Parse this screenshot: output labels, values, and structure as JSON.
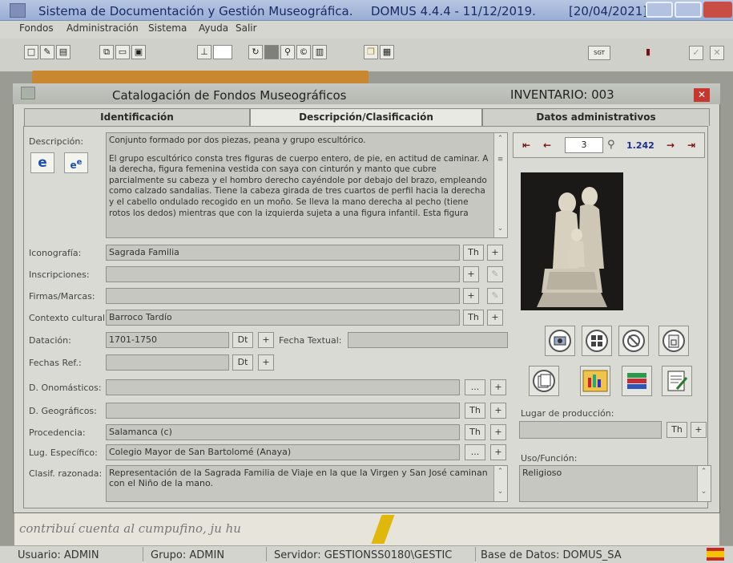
{
  "app": {
    "title": "Sistema de Documentación y Gestión Museográfica.",
    "version": "DOMUS 4.4.4 - 11/12/2019.",
    "date": "[20/04/2021]"
  },
  "menu": [
    "Fondos",
    "Administración",
    "Sistema",
    "Ayuda",
    "Salir"
  ],
  "dialog": {
    "title": "Catalogación de Fondos Museográficos",
    "inventory": "INVENTARIO: 003",
    "tabs": [
      "Identificación",
      "Descripción/Clasificación",
      "Datos administrativos"
    ],
    "active_tab": "Descripción/Clasificación"
  },
  "navigator": {
    "current": "3",
    "total": "1.242"
  },
  "form": {
    "descripcion_label": "Descripción:",
    "descripcion_p1": "Conjunto formado por dos piezas, peana y grupo escultórico.",
    "descripcion_p2": "El grupo escultórico consta tres figuras de cuerpo entero, de pie, en actitud de caminar. A la derecha, figura femenina vestida con saya con cinturón y manto que cubre parcialmente su cabeza y el hombro derecho cayéndole por debajo del brazo, empleando como calzado sandalias. Tiene la cabeza girada de tres cuartos de perfil hacia la derecha y el cabello ondulado recogido en un moño. Se lleva la mano derecha al pecho (tiene rotos los dedos) mientras que con la izquierda sujeta a una figura infantil. Esta figura",
    "iconografia": {
      "label": "Iconografía:",
      "value": "Sagrada Familia"
    },
    "inscripciones": {
      "label": "Inscripciones:",
      "value": ""
    },
    "firmas": {
      "label": "Firmas/Marcas:",
      "value": ""
    },
    "contexto": {
      "label": "Contexto cultural:",
      "value": "Barroco Tardío"
    },
    "datacion": {
      "label": "Datación:",
      "value": "1701-1750"
    },
    "fecha_textual": {
      "label": "Fecha Textual:",
      "value": ""
    },
    "fechas_ref": {
      "label": "Fechas Ref.:",
      "value": ""
    },
    "onomasticos": {
      "label": "D. Onomásticos:",
      "value": ""
    },
    "geograficos": {
      "label": "D. Geográficos:",
      "value": ""
    },
    "procedencia": {
      "label": "Procedencia:",
      "value": "Salamanca (c)"
    },
    "lug_especifico": {
      "label": "Lug. Específico:",
      "value": "Colegio Mayor de San Bartolomé (Anaya)"
    },
    "clasif": {
      "label": "Clasif. razonada:",
      "value": "Representación de la Sagrada Familia de Viaje en la que la Virgen y San José caminan con el Niño de la mano."
    },
    "lugar_produccion": {
      "label": "Lugar de producción:",
      "value": ""
    },
    "uso": {
      "label": "Uso/Función:",
      "value": "Religioso"
    }
  },
  "buttons": {
    "th": "Th",
    "plus": "+",
    "dt": "Dt",
    "dots": "..."
  },
  "toolbar": {
    "sgt": "SGT"
  },
  "status": {
    "usuario": "Usuario: ADMIN",
    "grupo": "Grupo: ADMIN",
    "servidor": "Servidor: GESTIONSS0180\\GESTIC",
    "base": "Base de Datos: DOMUS_SA"
  },
  "background_text": "contribuí cuenta al cumpufino, ju hu",
  "colors": {
    "accent_red": "#c8372d",
    "nav_blue": "#1d2c8f",
    "title_blue": "#1a2a66"
  }
}
